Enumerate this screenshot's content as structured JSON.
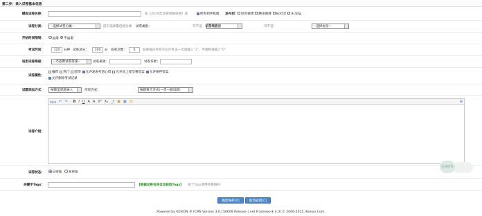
{
  "step_title": "第二步：录入试卷基本信息",
  "name_row": {
    "label": "模拟试卷名称：",
    "value": "",
    "hint": "在《2010年法律资格资格》等",
    "mobile_text": "所有到手机版",
    "publish_label": "发布到：",
    "publish_options": [
      "综合微博",
      "腾讯微博",
      "8c社交",
      "8c论坛"
    ]
  },
  "category_row": {
    "label": "试卷分类：",
    "category_select": "--选择试卷分类--",
    "category_hint": "提示选择最后级分类",
    "type_label": "试卷类别：",
    "type_select": "历年真题",
    "type_hint": "可不选",
    "region_label": "试卷地区：",
    "region_select": "--选择省份--",
    "region_hint": "可不选"
  },
  "timelimit_row": {
    "label": "开始时间限制：",
    "opt_enable": "启用",
    "opt_disable": "不启用"
  },
  "exam_row": {
    "label": "考试时间：",
    "minutes": "120",
    "minutes_unit": "分钟",
    "total_label": "试卷总分：",
    "total": "100",
    "total_unit": "分",
    "count_label": "答卷次数：",
    "count": "0",
    "hint": "如果每日考卷只允许考试一次请输入\"1\"，不限制请输入\"0\""
  },
  "apply_row": {
    "label": "适用试卷等级：",
    "grade_select": "--不适用试卷等级--",
    "source_label": "试卷来源：",
    "author_label": "试卷作者："
  },
  "attr_row": {
    "label": "试卷属性：",
    "options": [
      "推荐",
      "热门",
      "固顶",
      "允许发表考后心得",
      "允许马上提交看答案",
      "允许保存答案",
      "允许删除考试记录"
    ]
  },
  "add_row": {
    "label": "试题添加方式：",
    "mode_select": "按题型逐题录入",
    "group_label": "作答方式：",
    "group_select": "按题数卡方式(一页一题试题)"
  },
  "intro_row": {
    "label": "试卷介绍："
  },
  "toolbar": {
    "source": "html",
    "undo": "↶",
    "redo": "↷",
    "bold": "B",
    "italic": "I",
    "underline": "U",
    "strike": "A",
    "clear": "A̶",
    "sup": "X²",
    "sub": "X₂",
    "link": "⤴",
    "image": "▣",
    "flash": "▦",
    "emoji": "☺",
    "fullscreen": "⊞"
  },
  "status_row": {
    "label": "试卷状态：",
    "opt_reviewed": "已审核",
    "opt_unreviewed": "未审核"
  },
  "tags_row": {
    "label": "关键字Tags：",
    "value": "",
    "auto_tags": "【根据试卷名称自动获取Tags】",
    "hint": "多个Tags请用空格隔开"
  },
  "buttons": {
    "save": "确定保存(O)",
    "cancel": "取消返回(C)"
  },
  "footer": "Powered by KESION ® ICMS Version 3.0.150609 Release (.net Framework 4.0) © 2006-2015, Kesion.Com.",
  "float_widget": "在线咨询"
}
